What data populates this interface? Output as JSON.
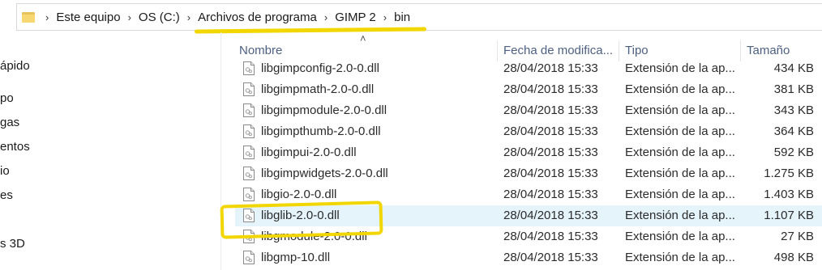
{
  "breadcrumbs": [
    "Este equipo",
    "OS (C:)",
    "Archivos de programa",
    "GIMP 2",
    "bin"
  ],
  "nav": [
    "ápido",
    "po",
    "gas",
    "entos",
    "io",
    "es",
    "s 3D"
  ],
  "columns": {
    "name": "Nombre",
    "date": "Fecha de modifica...",
    "type": "Tipo",
    "size": "Tamaño"
  },
  "files": [
    {
      "name": "libgimpconfig-2.0-0.dll",
      "date": "28/04/2018 15:33",
      "type": "Extensión de la ap...",
      "size": "434 KB"
    },
    {
      "name": "libgimpmath-2.0-0.dll",
      "date": "28/04/2018 15:33",
      "type": "Extensión de la ap...",
      "size": "381 KB"
    },
    {
      "name": "libgimpmodule-2.0-0.dll",
      "date": "28/04/2018 15:33",
      "type": "Extensión de la ap...",
      "size": "343 KB"
    },
    {
      "name": "libgimpthumb-2.0-0.dll",
      "date": "28/04/2018 15:33",
      "type": "Extensión de la ap...",
      "size": "364 KB"
    },
    {
      "name": "libgimpui-2.0-0.dll",
      "date": "28/04/2018 15:33",
      "type": "Extensión de la ap...",
      "size": "592 KB"
    },
    {
      "name": "libgimpwidgets-2.0-0.dll",
      "date": "28/04/2018 15:33",
      "type": "Extensión de la ap...",
      "size": "1.275 KB"
    },
    {
      "name": "libgio-2.0-0.dll",
      "date": "28/04/2018 15:33",
      "type": "Extensión de la ap...",
      "size": "1.403 KB"
    },
    {
      "name": "libglib-2.0-0.dll",
      "date": "28/04/2018 15:33",
      "type": "Extensión de la ap...",
      "size": "1.107 KB"
    },
    {
      "name": "libgmodule-2.0-0.dll",
      "date": "28/04/2018 15:33",
      "type": "Extensión de la ap...",
      "size": "27 KB"
    },
    {
      "name": "libgmp-10.dll",
      "date": "28/04/2018 15:33",
      "type": "Extensión de la ap...",
      "size": "498 KB"
    }
  ],
  "selected_file": "libglib-2.0-0.dll",
  "colors": {
    "highlight": "#f2d600",
    "selected_row": "#e5f3fb",
    "header_text": "#4d6082"
  }
}
